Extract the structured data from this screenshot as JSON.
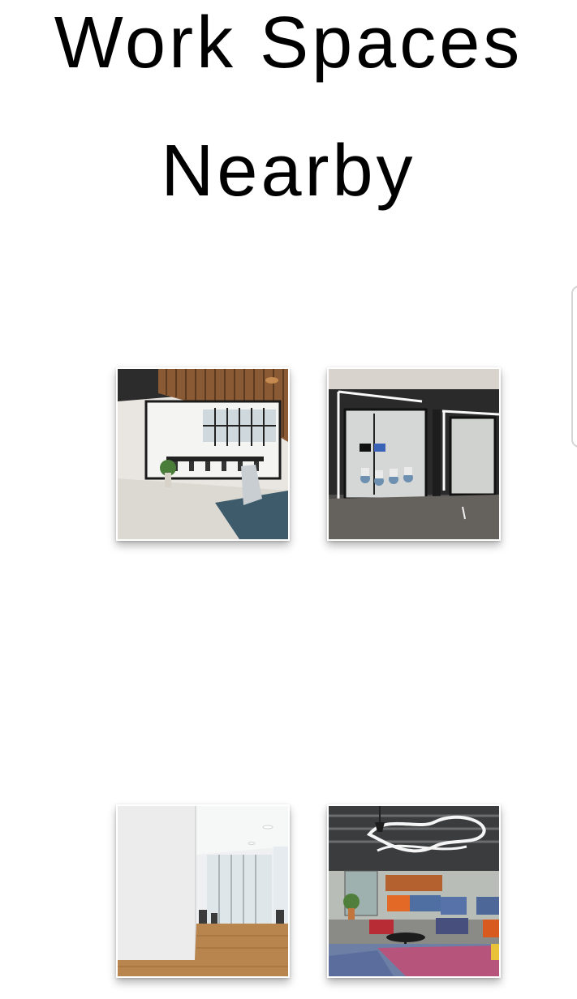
{
  "header": {
    "title_line_1": "Work Spaces",
    "title_line_2": "Nearby"
  },
  "workspaces": [
    {
      "photo": "glass-walled-meeting-room-image"
    },
    {
      "photo": "glass-office-pods-image"
    },
    {
      "photo": "bright-white-office-image"
    },
    {
      "photo": "colorful-lounge-area-image"
    }
  ]
}
